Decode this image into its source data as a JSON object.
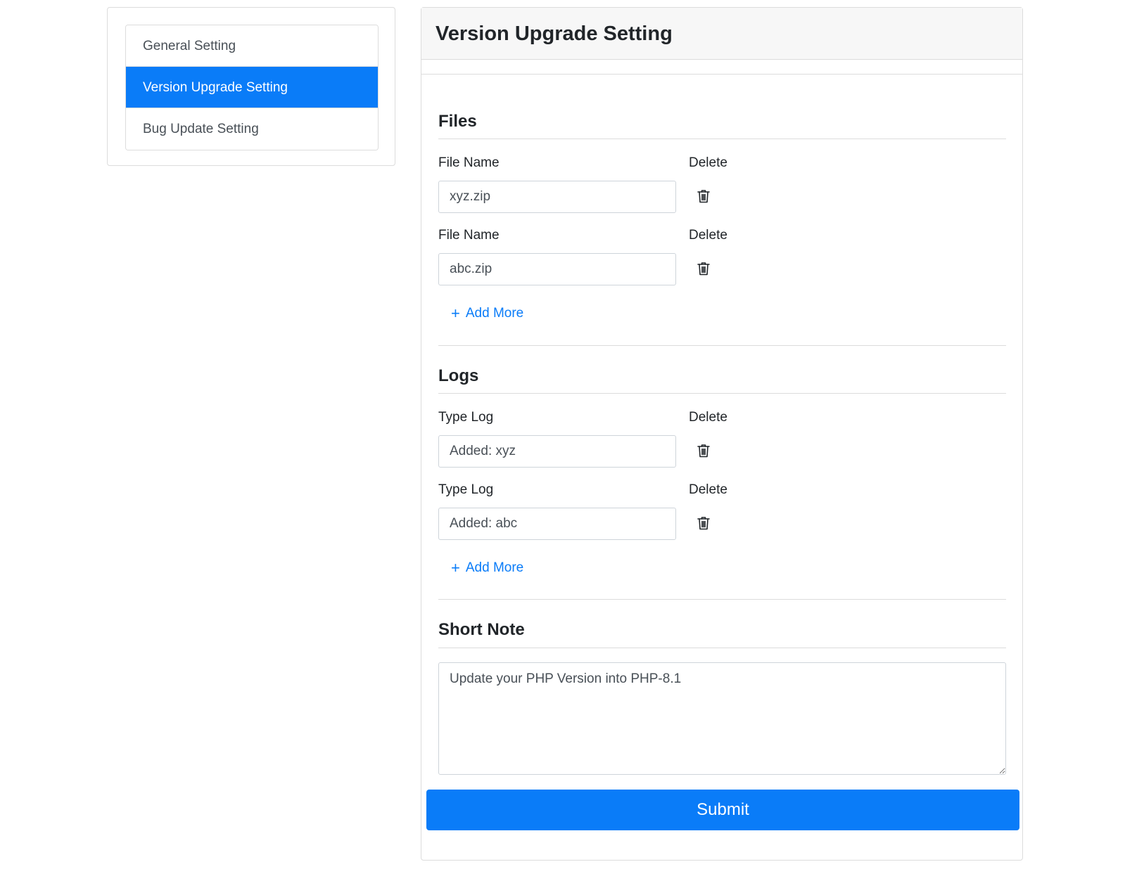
{
  "sidebar": {
    "items": [
      {
        "label": "General Setting"
      },
      {
        "label": "Version Upgrade Setting"
      },
      {
        "label": "Bug Update Setting"
      }
    ],
    "active_index": 1
  },
  "main": {
    "title": "Version Upgrade Setting",
    "files": {
      "heading": "Files",
      "rows": [
        {
          "name_label": "File Name",
          "delete_label": "Delete",
          "value": "xyz.zip"
        },
        {
          "name_label": "File Name",
          "delete_label": "Delete",
          "value": "abc.zip"
        }
      ],
      "add_more_label": "Add More"
    },
    "logs": {
      "heading": "Logs",
      "rows": [
        {
          "name_label": "Type Log",
          "delete_label": "Delete",
          "value": "Added: xyz"
        },
        {
          "name_label": "Type Log",
          "delete_label": "Delete",
          "value": "Added: abc"
        }
      ],
      "add_more_label": "Add More"
    },
    "short_note": {
      "heading": "Short Note",
      "value": "Update your PHP Version into PHP-8.1"
    },
    "submit_label": "Submit"
  },
  "colors": {
    "accent": "#0a7cf8",
    "border": "#dcdcdc",
    "header_bg": "#f7f7f7"
  },
  "icons": {
    "delete": "trash-icon",
    "add": "plus-icon"
  }
}
